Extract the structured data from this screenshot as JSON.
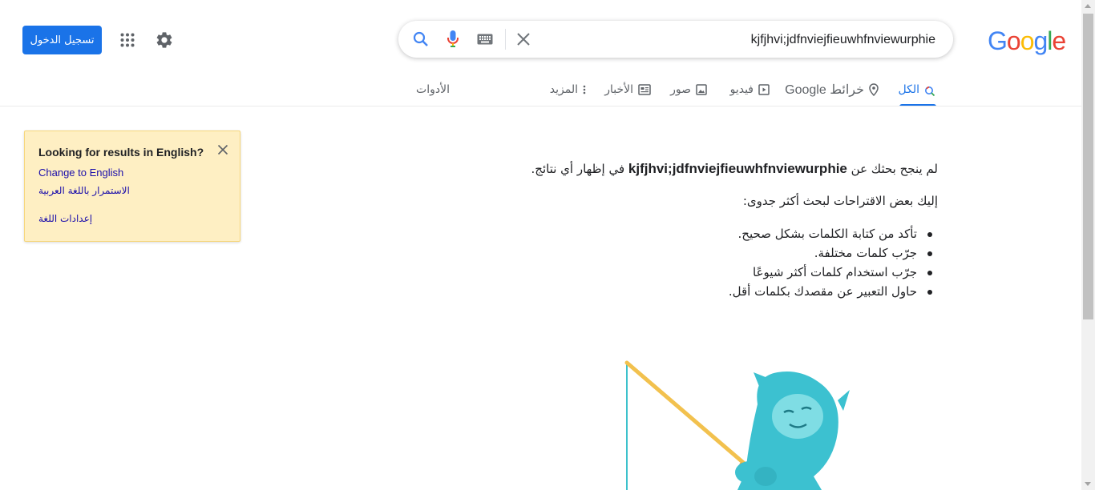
{
  "header": {
    "logo_letters": [
      "G",
      "o",
      "o",
      "g",
      "l",
      "e"
    ],
    "search_value": "kjfjhvi;jdfnviejfieuwhfnviewurphie",
    "signin_label": "تسجيل الدخول"
  },
  "tabs": [
    {
      "label": "الكل",
      "icon": "search-icon",
      "active": true
    },
    {
      "label": "خرائط Google",
      "icon": "map-pin-icon",
      "active": false
    },
    {
      "label": "فيديو",
      "icon": "video-icon",
      "active": false
    },
    {
      "label": "صور",
      "icon": "image-icon",
      "active": false
    },
    {
      "label": "الأخبار",
      "icon": "news-icon",
      "active": false
    },
    {
      "label": "المزيد",
      "icon": "more-vert-icon",
      "active": false
    },
    {
      "label": "الأدوات",
      "active": false
    }
  ],
  "lang_notice": {
    "title": "Looking for results in English?",
    "change_link": "Change to English",
    "continue_link": "الاستمرار باللغة العربية",
    "settings_link": "إعدادات اللغة"
  },
  "results": {
    "no_results_prefix": "لم ينجح بحثك عن",
    "no_results_query": "kjfjhvi;jdfnviejfieuwhfnviewurphie",
    "no_results_suffix": "في إظهار أي نتائج.",
    "suggestions_intro": "إليك بعض الاقتراحات لبحث أكثر جدوى:",
    "suggestions": [
      "تأكد من كتابة الكلمات بشكل صحيح.",
      "جرّب كلمات مختلفة.",
      "جرّب استخدام كلمات أكثر شيوعًا",
      "حاول التعبير عن مقصدك بكلمات أقل."
    ]
  },
  "colors": {
    "accent": "#1a73e8",
    "link": "#1a0dab",
    "notice_bg": "#feefc3",
    "logo": [
      "#4285f4",
      "#ea4335",
      "#fbbc05",
      "#4285f4",
      "#34a853",
      "#ea4335"
    ]
  }
}
